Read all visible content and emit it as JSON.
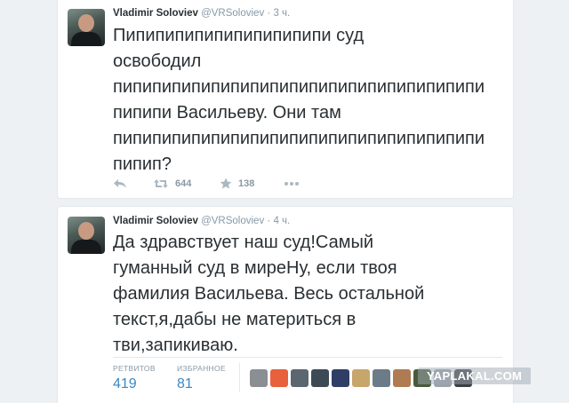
{
  "tweets": [
    {
      "name": "Vladimir Soloviev",
      "handle": "@VRSoloviev",
      "separator": "·",
      "time": "3 ч.",
      "text_lines": [
        "Пипипипипипипипипипипи суд",
        "освободил",
        "пипипипипипипипипипипипипипипипипипипи",
        "пипипи Васильеву. Они там",
        "пипипипипипипипипипипипипипипипипипипи",
        "пипип?"
      ],
      "actions": {
        "reply_icon": "reply-icon",
        "retweet_icon": "retweet-icon",
        "retweet_count": "644",
        "favorite_icon": "star-icon",
        "favorite_count": "138",
        "more_icon": "more-icon"
      }
    },
    {
      "name": "Vladimir Soloviev",
      "handle": "@VRSoloviev",
      "separator": "·",
      "time": "4 ч.",
      "text_lines": [
        "Да здравствует наш суд!Самый",
        "гуманный суд в миреНу, если твоя",
        "фамилия Васильева. Весь остальной",
        "текст,я,дабы не материться в",
        "тви,запикиваю."
      ],
      "stats": {
        "retweets_label": "РЕТВИТОВ",
        "retweets_value": "419",
        "favorites_label": "ИЗБРАННОЕ",
        "favorites_value": "81"
      },
      "favoriter_avatars": [
        "#8a8f94",
        "#e8603c",
        "#5b6670",
        "#3c4a56",
        "#2e3e66",
        "#c8a56a",
        "#6c7b88",
        "#b07a52",
        "#4a5a3c",
        "#9aa3ab",
        "#3a3f44"
      ]
    }
  ],
  "watermark": "YAPLAKAL.COM"
}
